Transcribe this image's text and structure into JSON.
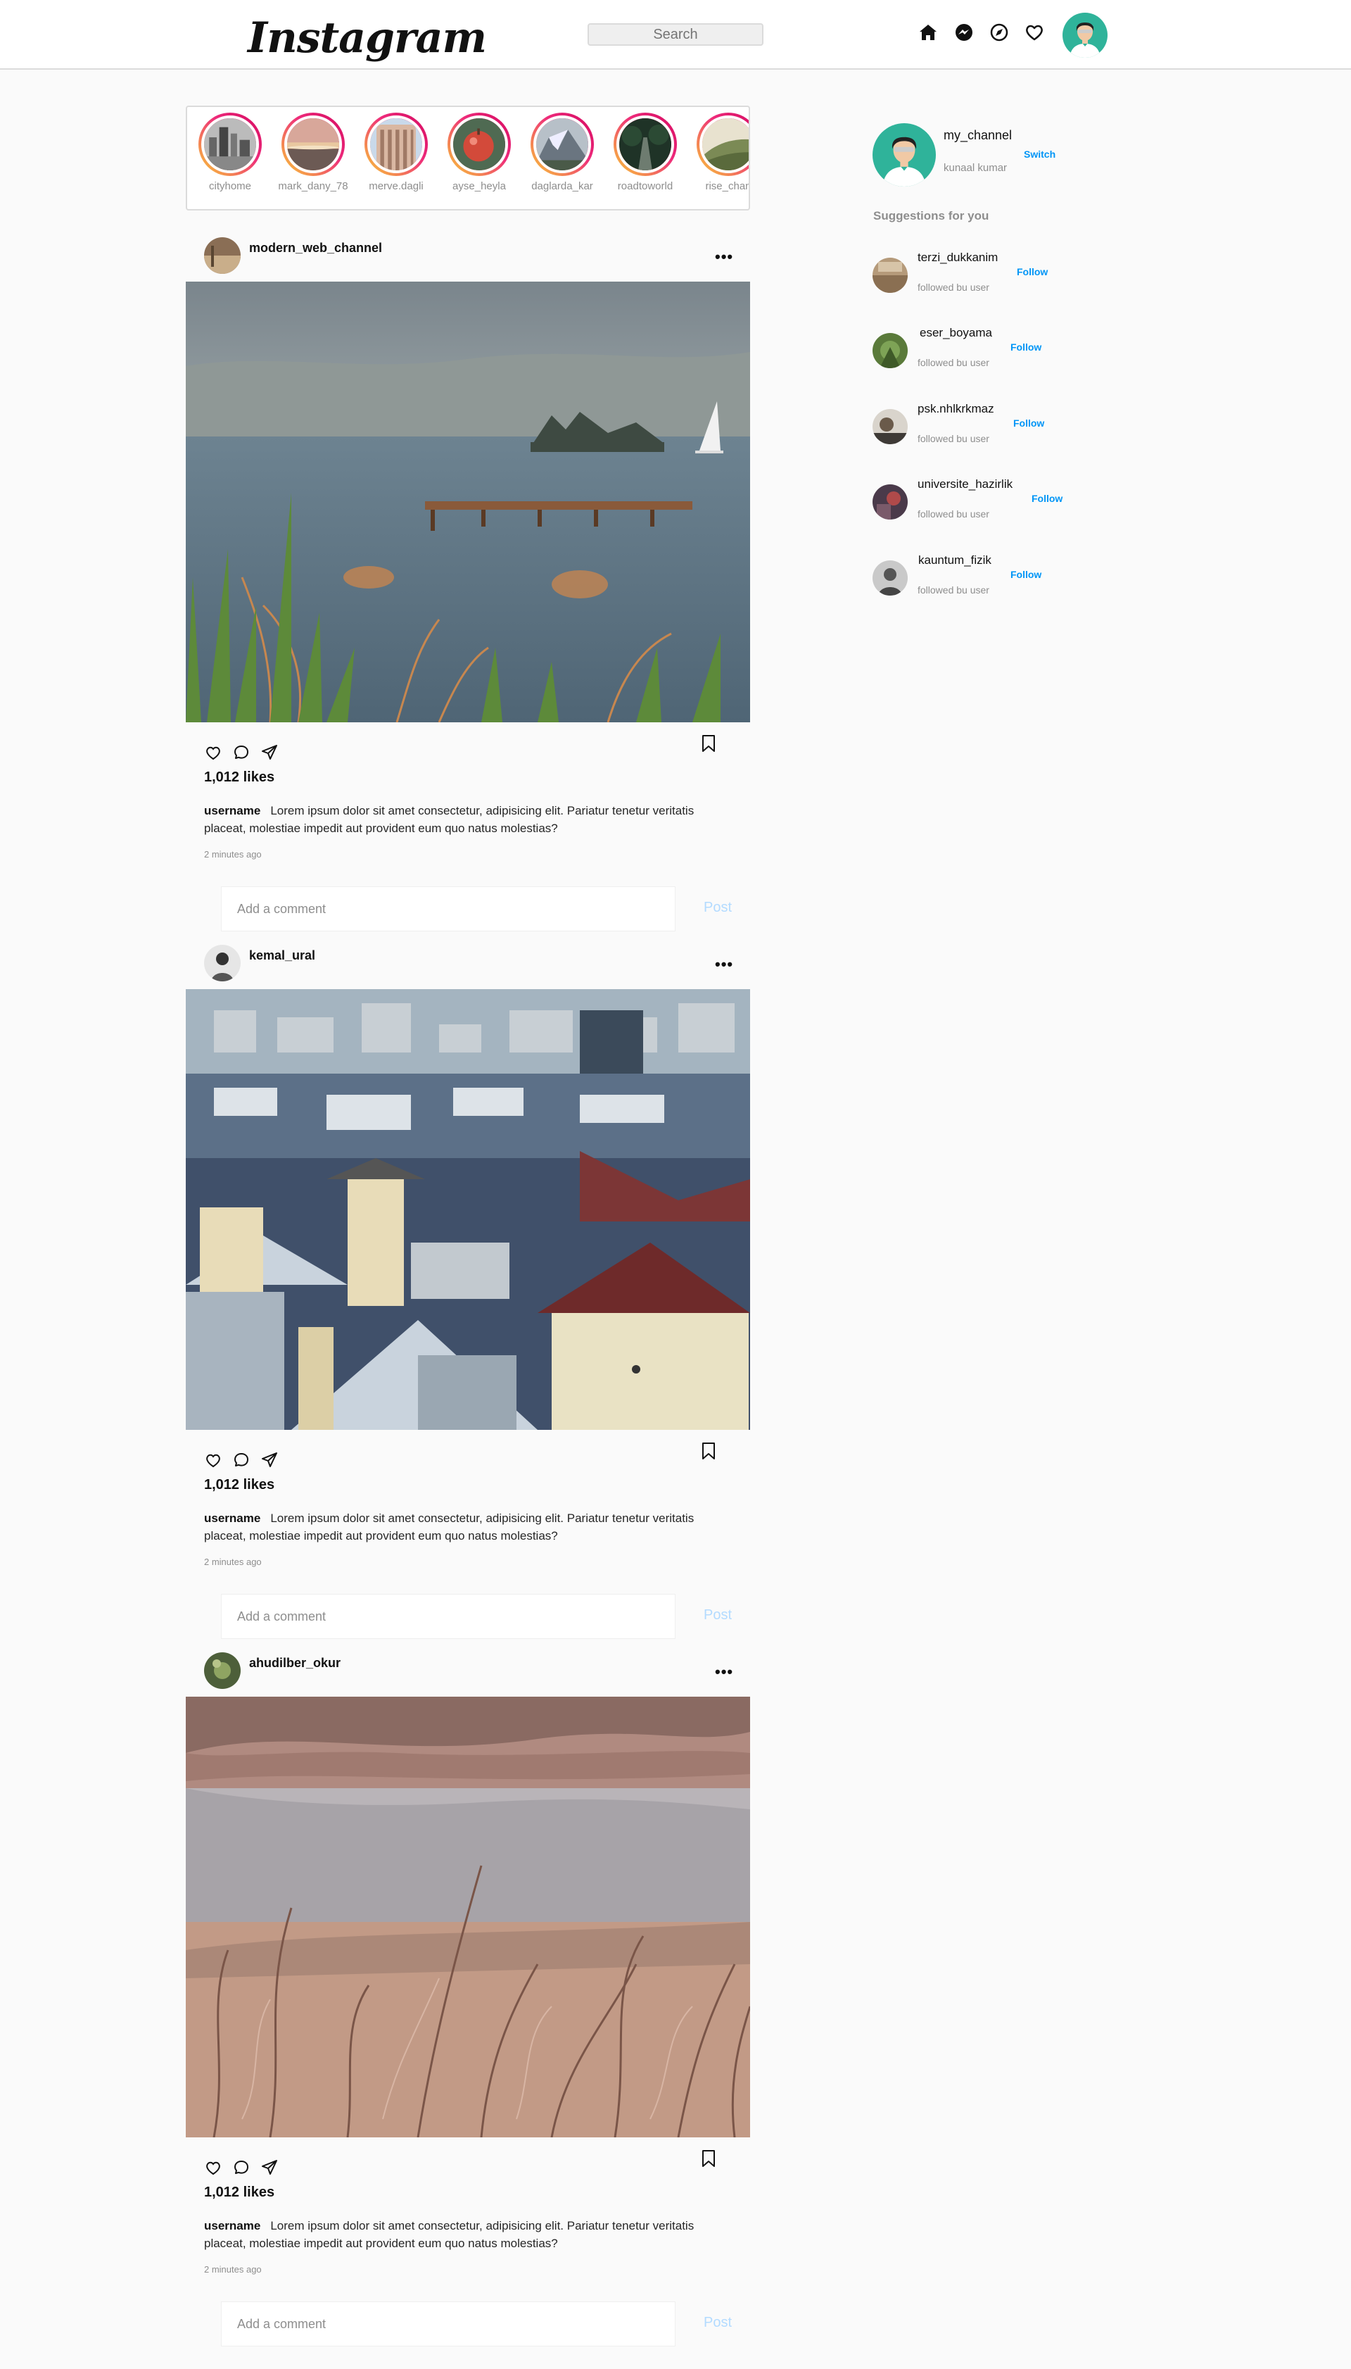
{
  "header": {
    "logo": "Instagram",
    "search_placeholder": "Search",
    "icons": [
      "home-icon",
      "messenger-icon",
      "explore-icon",
      "heart-icon"
    ]
  },
  "stories": [
    {
      "name": "cityhome"
    },
    {
      "name": "mark_dany_78"
    },
    {
      "name": "merve.dagli"
    },
    {
      "name": "ayse_heyla"
    },
    {
      "name": "daglarda_kar"
    },
    {
      "name": "roadtoworld"
    },
    {
      "name": "rise_chan"
    }
  ],
  "posts": [
    {
      "username": "modern_web_channel",
      "likes": "1,012 likes",
      "caption_user": "username",
      "caption": "Lorem ipsum dolor sit amet consectetur, adipisicing elit. Pariatur tenetur veritatis placeat, molestiae impedit aut provident eum quo natus molestias?",
      "time": "2 minutes ago",
      "comment_placeholder": "Add a comment",
      "post_label": "Post"
    },
    {
      "username": "kemal_ural",
      "likes": "1,012 likes",
      "caption_user": "username",
      "caption": "Lorem ipsum dolor sit amet consectetur, adipisicing elit. Pariatur tenetur veritatis placeat, molestiae impedit aut provident eum quo natus molestias?",
      "time": "2 minutes ago",
      "comment_placeholder": "Add a comment",
      "post_label": "Post"
    },
    {
      "username": "ahudilber_okur",
      "likes": "1,012 likes",
      "caption_user": "username",
      "caption": "Lorem ipsum dolor sit amet consectetur, adipisicing elit. Pariatur tenetur veritatis placeat, molestiae impedit aut provident eum quo natus molestias?",
      "time": "2 minutes ago",
      "comment_placeholder": "Add a comment",
      "post_label": "Post"
    }
  ],
  "sidebar": {
    "profile": {
      "username": "my_channel",
      "name": "kunaal kumar",
      "switch_label": "Switch"
    },
    "suggestions_title": "Suggestions for you",
    "suggestions": [
      {
        "username": "terzi_dukkanim",
        "sub": "followed bu user",
        "follow_label": "Follow"
      },
      {
        "username": "eser_boyama",
        "sub": "followed bu user",
        "follow_label": "Follow"
      },
      {
        "username": "psk.nhlkrkmaz",
        "sub": "followed bu user",
        "follow_label": "Follow"
      },
      {
        "username": "universite_hazirlik",
        "sub": "followed bu user",
        "follow_label": "Follow"
      },
      {
        "username": "kauntum_fizik",
        "sub": "followed bu user",
        "follow_label": "Follow"
      }
    ]
  },
  "colors": {
    "link_blue": "#0095f6",
    "post_button_disabled": "#b3dbff",
    "border": "#dbdbdb",
    "background": "#fafafa",
    "avatar_teal": "#2fb39a"
  }
}
